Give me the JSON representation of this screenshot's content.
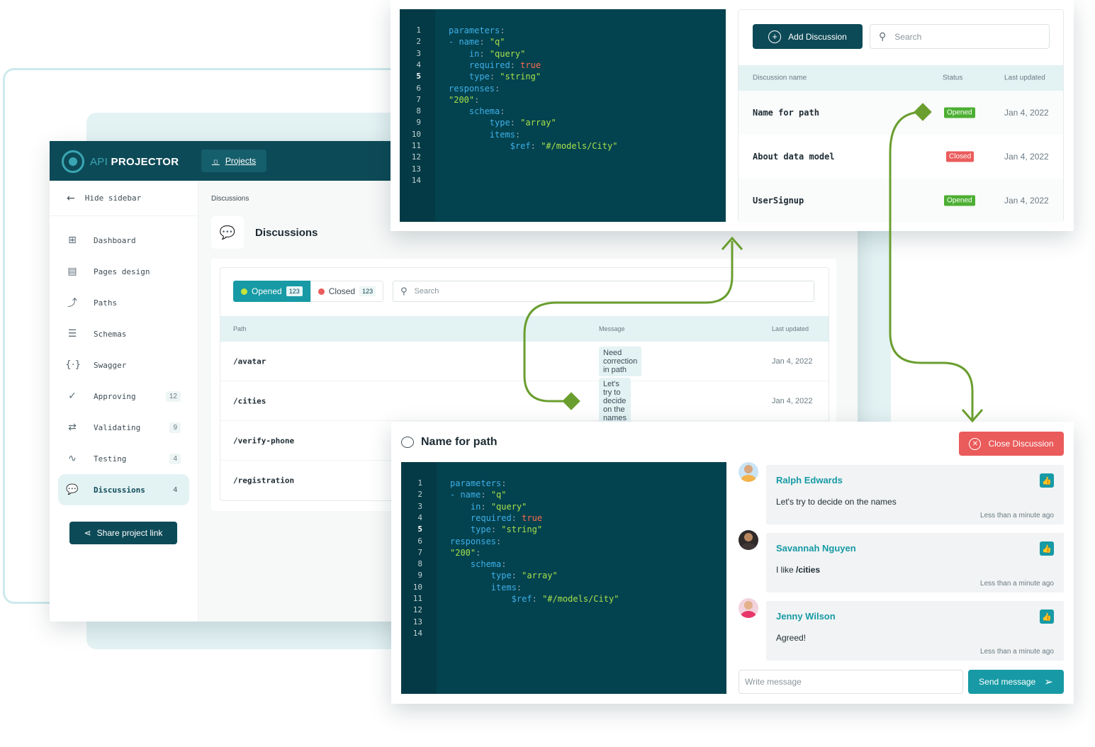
{
  "app": {
    "logo_api": "API",
    "logo_name": "PROJECTOR",
    "projects_label": "Projects"
  },
  "sidebar": {
    "hide_label": "Hide sidebar",
    "items": [
      {
        "label": "Dashboard",
        "icon": "grid-icon",
        "badge": ""
      },
      {
        "label": "Pages design",
        "icon": "page-icon",
        "badge": ""
      },
      {
        "label": "Paths",
        "icon": "path-icon",
        "badge": ""
      },
      {
        "label": "Schemas",
        "icon": "schema-icon",
        "badge": ""
      },
      {
        "label": "Swagger",
        "icon": "braces-icon",
        "badge": ""
      },
      {
        "label": "Approving",
        "icon": "check-badge-icon",
        "badge": "12"
      },
      {
        "label": "Validating",
        "icon": "swap-icon",
        "badge": "9"
      },
      {
        "label": "Testing",
        "icon": "pulse-icon",
        "badge": "4"
      },
      {
        "label": "Discussions",
        "icon": "chat-icon",
        "badge": "4"
      }
    ],
    "share_label": "Share project link"
  },
  "main": {
    "breadcrumb": "Discussions",
    "title": "Discussions",
    "filters": {
      "opened_label": "Opened",
      "opened_count": "123",
      "closed_label": "Closed",
      "closed_count": "123"
    },
    "search_placeholder": "Search",
    "columns": {
      "path": "Path",
      "message": "Message",
      "updated": "Last updated"
    },
    "rows": [
      {
        "path": "/avatar",
        "message": "Need correction in path",
        "date": "Jan 4, 2022"
      },
      {
        "path": "/cities",
        "message": "Let's try to decide on the names",
        "date": "Jan 4, 2022"
      },
      {
        "path": "/verify-phone",
        "message": "",
        "date": ""
      },
      {
        "path": "/registration",
        "message": "",
        "date": ""
      }
    ]
  },
  "code": {
    "line_numbers": [
      "1",
      "2",
      "3",
      "4",
      "5",
      "6",
      "7",
      "8",
      "9",
      "10",
      "11",
      "12",
      "13",
      "14"
    ],
    "highlighted_line": "5"
  },
  "discussions_panel": {
    "add_label": "Add Discussion",
    "search_placeholder": "Search",
    "columns": {
      "name": "Discussion name",
      "status": "Status",
      "updated": "Last updated"
    },
    "rows": [
      {
        "name": "Name for path",
        "status": "Opened",
        "date": "Jan 4, 2022"
      },
      {
        "name": "About data model",
        "status": "Closed",
        "date": "Jan 4, 2022"
      },
      {
        "name": "UserSignup",
        "status": "Opened",
        "date": "Jan 4, 2022"
      }
    ]
  },
  "detail": {
    "title": "Name for path",
    "close_label": "Close Discussion",
    "comments": [
      {
        "author": "Ralph Edwards",
        "text": "Let's try to decide on the names",
        "text_bold": "",
        "time": "Less than a minute ago"
      },
      {
        "author": "Savannah Nguyen",
        "text": "I like ",
        "text_bold": "/cities",
        "time": "Less than a minute ago"
      },
      {
        "author": "Jenny Wilson",
        "text": "Agreed!",
        "text_bold": "",
        "time": "Less than a minute ago"
      }
    ],
    "write_placeholder": "Write message",
    "send_label": "Send message"
  },
  "colors": {
    "primary": "#0d4a57",
    "accent": "#179aa5",
    "danger": "#ea5b5b",
    "success": "#4caf32",
    "connector": "#6a9e2f"
  }
}
